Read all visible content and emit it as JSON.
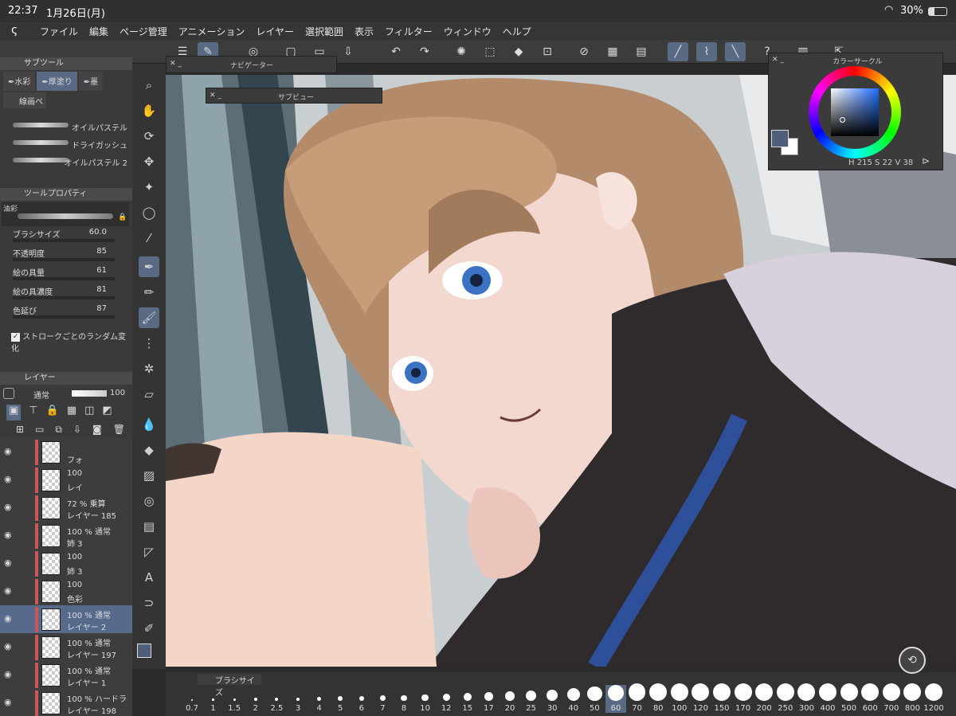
{
  "status": {
    "time": "22:37",
    "date": "1月26日(月)",
    "battery": "30%"
  },
  "menu": [
    "ファイル",
    "編集",
    "ページ管理",
    "アニメーション",
    "レイヤー",
    "選択範囲",
    "表示",
    "フィルター",
    "ウィンドウ",
    "ヘルプ"
  ],
  "subtool": {
    "title": "サブツール",
    "tabs": [
      "水彩",
      "厚塗り",
      "墨"
    ],
    "group": "線画ペ",
    "brushes": [
      "オイルパステル",
      "ドライガッシュ",
      "オイルパステル 2"
    ]
  },
  "toolprop": {
    "title": "ツールプロパティ",
    "preset": "油彩",
    "props": [
      {
        "label": "ブラシサイズ",
        "value": "60.0"
      },
      {
        "label": "不透明度",
        "value": "85"
      },
      {
        "label": "絵の具量",
        "value": "61"
      },
      {
        "label": "絵の具濃度",
        "value": "81"
      },
      {
        "label": "色延び",
        "value": "87"
      }
    ],
    "checkbox": "ストロークごとのランダム変化"
  },
  "layers": {
    "title": "レイヤー",
    "blend": "通常",
    "opacity": "100",
    "rows": [
      {
        "pct": "",
        "name": "フォ",
        "selected": false
      },
      {
        "pct": "100",
        "name": "レイ",
        "selected": false
      },
      {
        "pct": "72 % 乗算",
        "name": "レイヤー 185",
        "selected": false
      },
      {
        "pct": "100 % 通常",
        "name": "姉 3",
        "selected": false
      },
      {
        "pct": "100",
        "name": "姉 3",
        "selected": false
      },
      {
        "pct": "100",
        "name": "色彩",
        "selected": false
      },
      {
        "pct": "100 % 通常",
        "name": "レイヤー 2",
        "selected": true
      },
      {
        "pct": "100 % 通常",
        "name": "レイヤー 197",
        "selected": false
      },
      {
        "pct": "100 % 通常",
        "name": "レイヤー 1",
        "selected": false
      },
      {
        "pct": "100 % ハードラ",
        "name": "レイヤー 198",
        "selected": false
      }
    ]
  },
  "navigator": {
    "title": "ナビゲーター"
  },
  "subview": {
    "title": "サブビュー"
  },
  "colorcircle": {
    "title": "カラーサークル",
    "h_label": "H",
    "h": "215",
    "s_label": "S",
    "s": "22",
    "v_label": "V",
    "v": "38",
    "fg": "#4f5f7a"
  },
  "brushsize": {
    "title": "ブラシサイズ",
    "sizes": [
      "0.7",
      "1",
      "1.5",
      "2",
      "2.5",
      "3",
      "4",
      "5",
      "6",
      "7",
      "8",
      "10",
      "12",
      "15",
      "17",
      "20",
      "25",
      "30",
      "40",
      "50",
      "60",
      "70",
      "80",
      "100",
      "120",
      "150",
      "170",
      "200",
      "250",
      "300",
      "400",
      "500",
      "600",
      "700",
      "800",
      "1200"
    ],
    "selected": "60"
  }
}
